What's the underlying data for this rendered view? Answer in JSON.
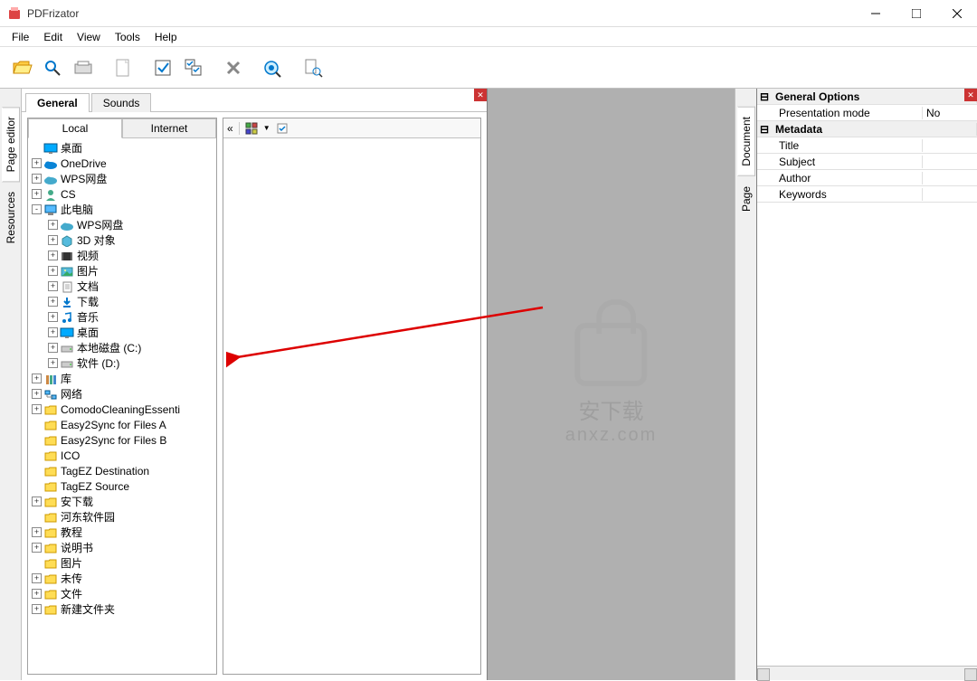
{
  "app": {
    "title": "PDFrizator"
  },
  "menu": [
    "File",
    "Edit",
    "View",
    "Tools",
    "Help"
  ],
  "left_vtabs": [
    "Page editor",
    "Resources"
  ],
  "right_vtabs": [
    "Document",
    "Page"
  ],
  "left_panel": {
    "tabs": [
      "General",
      "Sounds"
    ],
    "subtabs": [
      "Local",
      "Internet"
    ]
  },
  "tree": [
    {
      "depth": 0,
      "exp": "",
      "icon": "desktop",
      "label": "桌面"
    },
    {
      "depth": 0,
      "exp": "+",
      "icon": "onedrive",
      "label": "OneDrive"
    },
    {
      "depth": 0,
      "exp": "+",
      "icon": "cloud",
      "label": "WPS网盘"
    },
    {
      "depth": 0,
      "exp": "+",
      "icon": "user",
      "label": "CS"
    },
    {
      "depth": 0,
      "exp": "-",
      "icon": "pc",
      "label": "此电脑"
    },
    {
      "depth": 1,
      "exp": "+",
      "icon": "cloud",
      "label": "WPS网盘"
    },
    {
      "depth": 1,
      "exp": "+",
      "icon": "3d",
      "label": "3D 对象"
    },
    {
      "depth": 1,
      "exp": "+",
      "icon": "video",
      "label": "视频"
    },
    {
      "depth": 1,
      "exp": "+",
      "icon": "picture",
      "label": "图片"
    },
    {
      "depth": 1,
      "exp": "+",
      "icon": "doc",
      "label": "文档"
    },
    {
      "depth": 1,
      "exp": "+",
      "icon": "download",
      "label": "下载"
    },
    {
      "depth": 1,
      "exp": "+",
      "icon": "music",
      "label": "音乐"
    },
    {
      "depth": 1,
      "exp": "+",
      "icon": "desktop",
      "label": "桌面"
    },
    {
      "depth": 1,
      "exp": "+",
      "icon": "disk",
      "label": "本地磁盘 (C:)"
    },
    {
      "depth": 1,
      "exp": "+",
      "icon": "disk",
      "label": "软件 (D:)"
    },
    {
      "depth": 0,
      "exp": "+",
      "icon": "lib",
      "label": "库"
    },
    {
      "depth": 0,
      "exp": "+",
      "icon": "net",
      "label": "网络"
    },
    {
      "depth": 0,
      "exp": "+",
      "icon": "folder",
      "label": "ComodoCleaningEssenti"
    },
    {
      "depth": 0,
      "exp": "",
      "icon": "folder",
      "label": "Easy2Sync for Files A"
    },
    {
      "depth": 0,
      "exp": "",
      "icon": "folder",
      "label": "Easy2Sync for Files B"
    },
    {
      "depth": 0,
      "exp": "",
      "icon": "folder",
      "label": "ICO"
    },
    {
      "depth": 0,
      "exp": "",
      "icon": "folder",
      "label": "TagEZ Destination"
    },
    {
      "depth": 0,
      "exp": "",
      "icon": "folder",
      "label": "TagEZ Source"
    },
    {
      "depth": 0,
      "exp": "+",
      "icon": "folder",
      "label": "安下载"
    },
    {
      "depth": 0,
      "exp": "",
      "icon": "folder",
      "label": "河东软件园"
    },
    {
      "depth": 0,
      "exp": "+",
      "icon": "folder",
      "label": "教程"
    },
    {
      "depth": 0,
      "exp": "+",
      "icon": "folder",
      "label": "说明书"
    },
    {
      "depth": 0,
      "exp": "",
      "icon": "folder",
      "label": "图片"
    },
    {
      "depth": 0,
      "exp": "+",
      "icon": "folder",
      "label": "未传"
    },
    {
      "depth": 0,
      "exp": "+",
      "icon": "folder",
      "label": "文件"
    },
    {
      "depth": 0,
      "exp": "+",
      "icon": "folder",
      "label": "新建文件夹"
    }
  ],
  "properties": {
    "categories": [
      {
        "name": "General Options",
        "rows": [
          {
            "name": "Presentation mode",
            "value": "No"
          }
        ]
      },
      {
        "name": "Metadata",
        "rows": [
          {
            "name": "Title",
            "value": ""
          },
          {
            "name": "Subject",
            "value": ""
          },
          {
            "name": "Author",
            "value": ""
          },
          {
            "name": "Keywords",
            "value": ""
          }
        ]
      }
    ]
  },
  "watermark": {
    "text": "anxz.com"
  }
}
